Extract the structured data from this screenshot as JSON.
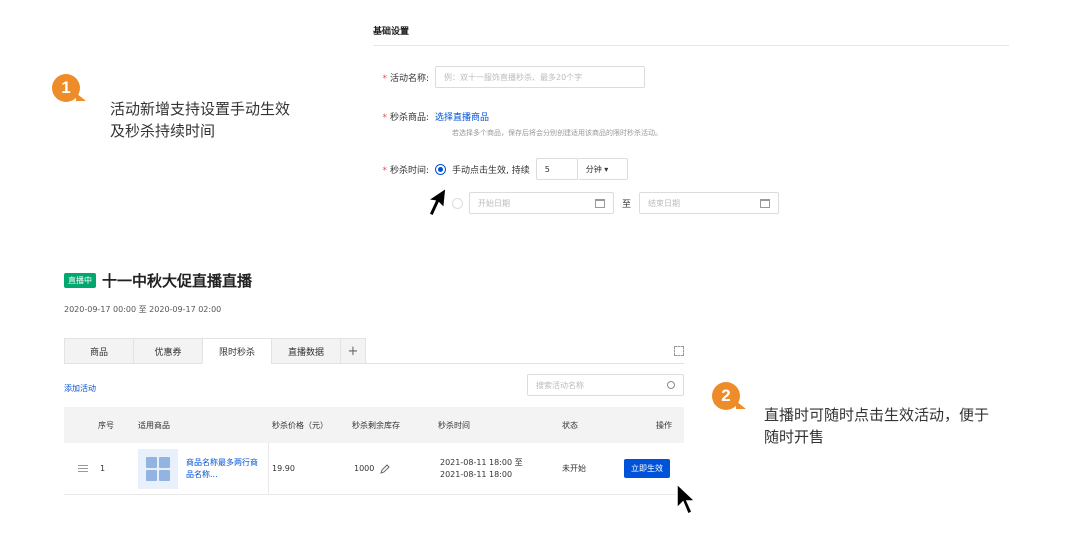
{
  "callouts": [
    {
      "number": "1",
      "line1": "活动新增支持设置手动生效",
      "line2": "及秒杀持续时间"
    },
    {
      "number": "2",
      "line1": "直播时可随时点击生效活动，便于",
      "line2": "随时开售"
    }
  ],
  "settings": {
    "section_title": "基础设置",
    "name_label": "活动名称:",
    "name_placeholder": "例：双十一服饰直播秒杀、最多20个字",
    "product_label": "秒杀商品:",
    "product_link": "选择直播商品",
    "product_hint": "若选择多个商品，保存后将会分别创建适用该商品的限时秒杀活动。",
    "time_label": "秒杀时间:",
    "manual_option": "手动点击生效, 持续",
    "duration_value": "5",
    "duration_unit": "分钟 ▾",
    "start_placeholder": "开始日期",
    "to_label": "至",
    "end_placeholder": "结束日期"
  },
  "live": {
    "badge": "直播中",
    "title": "十一中秋大促直播直播",
    "time_range": "2020-09-17 00:00 至 2020-09-17 02:00",
    "tabs": [
      "商品",
      "优惠券",
      "限时秒杀",
      "直播数据"
    ],
    "active_tab": "限时秒杀",
    "plus": "+",
    "add_activity": "添加活动",
    "search_placeholder": "搜索活动名称",
    "columns": [
      "序号",
      "适用商品",
      "秒杀价格（元）",
      "秒杀剩余库存",
      "秒杀时间",
      "状态",
      "操作"
    ],
    "row": {
      "index": "1",
      "product": "商品名称最多两行商品名称...",
      "price": "19.90",
      "stock": "1000",
      "time_line1": "2021-08-11 18:00 至",
      "time_line2": "2021-08-11 18:00",
      "status": "未开始",
      "action": "立即生效"
    }
  },
  "icons": {
    "calendar": "calendar-icon",
    "edit": "pencil-icon",
    "search": "search-icon",
    "expand": "expand-icon",
    "cursor": "mouse-pointer-icon",
    "drag": "drag-handle-icon"
  },
  "colors": {
    "accent": "#0052d9",
    "callout": "#ee8c2a",
    "live_badge": "#00a870",
    "required": "#e34d59"
  }
}
